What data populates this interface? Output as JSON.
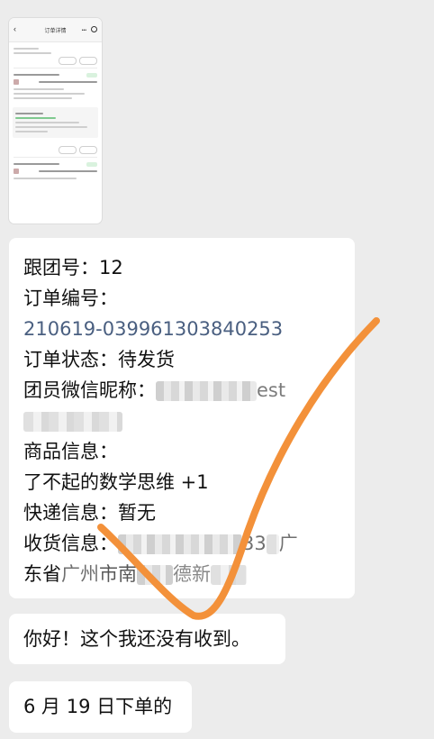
{
  "thumbnail": {
    "title": "订单详情"
  },
  "main_message": {
    "team_no_label": "跟团号：",
    "team_no_value": "12",
    "order_no_label": "订单编号：",
    "order_no_value": "210619-039961303840253",
    "status_label": "订单状态：",
    "status_value": "待发货",
    "nickname_label": "团员微信昵称：",
    "nickname_tail": "est",
    "product_label": "商品信息：",
    "product_value": "了不起的数学思维 +1",
    "express_label": "快递信息：",
    "express_value": "暂无",
    "receiver_label": "收货信息：",
    "receiver_fragment_1": "33",
    "receiver_fragment_2": "广",
    "address_1": "东省",
    "address_2": "广州",
    "address_3": "市南",
    "address_4": "德新"
  },
  "message_2": {
    "text": "你好！这个我还没有收到。"
  },
  "message_3": {
    "text": "6 月 19 日下单的"
  },
  "colors": {
    "background": "#ececec",
    "bubble": "#ffffff",
    "link": "#4a5f80",
    "checkmark": "#f3913a"
  },
  "icons": {
    "thumbnail_back": "chevron-left-icon",
    "check_mark": "check-mark-icon"
  }
}
